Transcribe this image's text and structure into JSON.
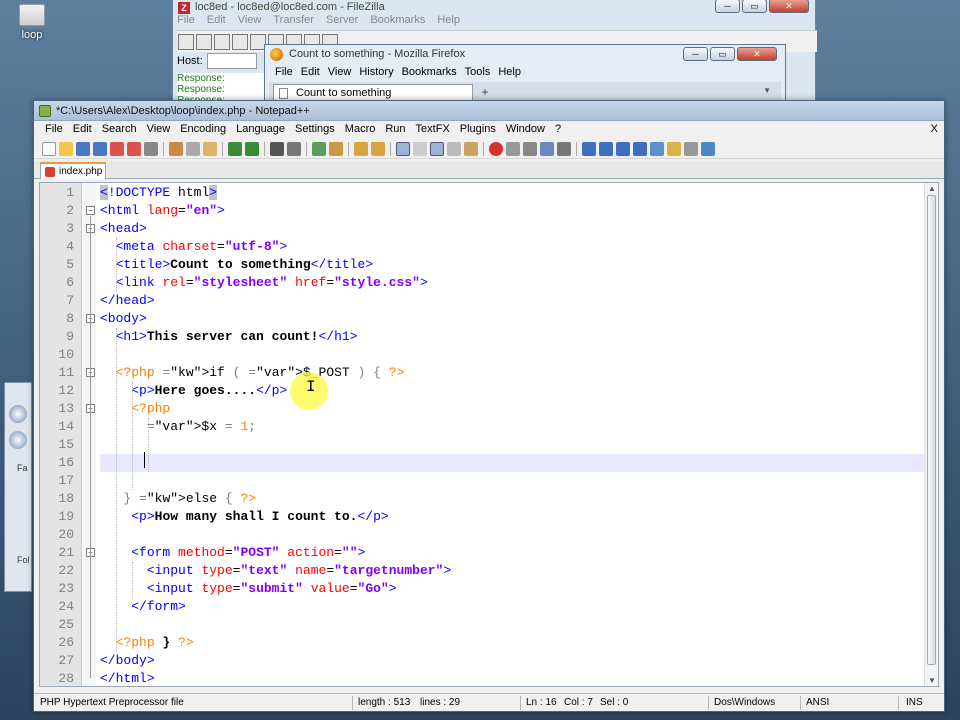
{
  "desktop": {
    "icon_label": "loop"
  },
  "filezilla": {
    "title": "loc8ed - loc8ed@loc8ed.com - FileZilla",
    "menus": [
      "File",
      "Edit",
      "View",
      "Transfer",
      "Server",
      "Bookmarks",
      "Help"
    ],
    "host_label": "Host:",
    "response_lines": [
      "Response:",
      "Response:",
      "Response:"
    ]
  },
  "firefox": {
    "title": "Count to something - Mozilla Firefox",
    "menus": [
      "File",
      "Edit",
      "View",
      "History",
      "Bookmarks",
      "Tools",
      "Help"
    ],
    "tab_title": "Count to something",
    "new_tab": "+"
  },
  "left_window": {
    "labels": [
      "Fa",
      "Fol"
    ]
  },
  "notepad": {
    "title": "*C:\\Users\\Alex\\Desktop\\loop\\index.php - Notepad++",
    "menus": [
      "File",
      "Edit",
      "Search",
      "View",
      "Encoding",
      "Language",
      "Settings",
      "Macro",
      "Run",
      "TextFX",
      "Plugins",
      "Window",
      "?"
    ],
    "close_x": "X",
    "tab_name": "index.php",
    "lines": [
      "<!DOCTYPE html>",
      "<html lang=\"en\">",
      "<head>",
      "  <meta charset=\"utf-8\">",
      "  <title>Count to something</title>",
      "  <link rel=\"stylesheet\" href=\"style.css\">",
      "</head>",
      "<body>",
      "  <h1>This server can count!</h1>",
      "",
      "  <?php if ( $_POST ) { ?>",
      "    <p>Here goes....</p>",
      "    <?php",
      "      $x = 1;",
      "",
      "",
      "",
      "   } else { ?>",
      "    <p>How many shall I count to.</p>",
      "",
      "    <form method=\"POST\" action=\"\">",
      "      <input type=\"text\" name=\"targetnumber\">",
      "      <input type=\"submit\" value=\"Go\">",
      "    </form>",
      "",
      "  <?php } ?>",
      "</body>",
      "</html>"
    ],
    "status": {
      "file_type": "PHP Hypertext Preprocessor file",
      "length": "length : 513",
      "lines": "lines : 29",
      "ln": "Ln : 16",
      "col": "Col : 7",
      "sel": "Sel : 0",
      "eol": "Dos\\Windows",
      "encoding": "ANSI",
      "mode": "INS"
    }
  }
}
